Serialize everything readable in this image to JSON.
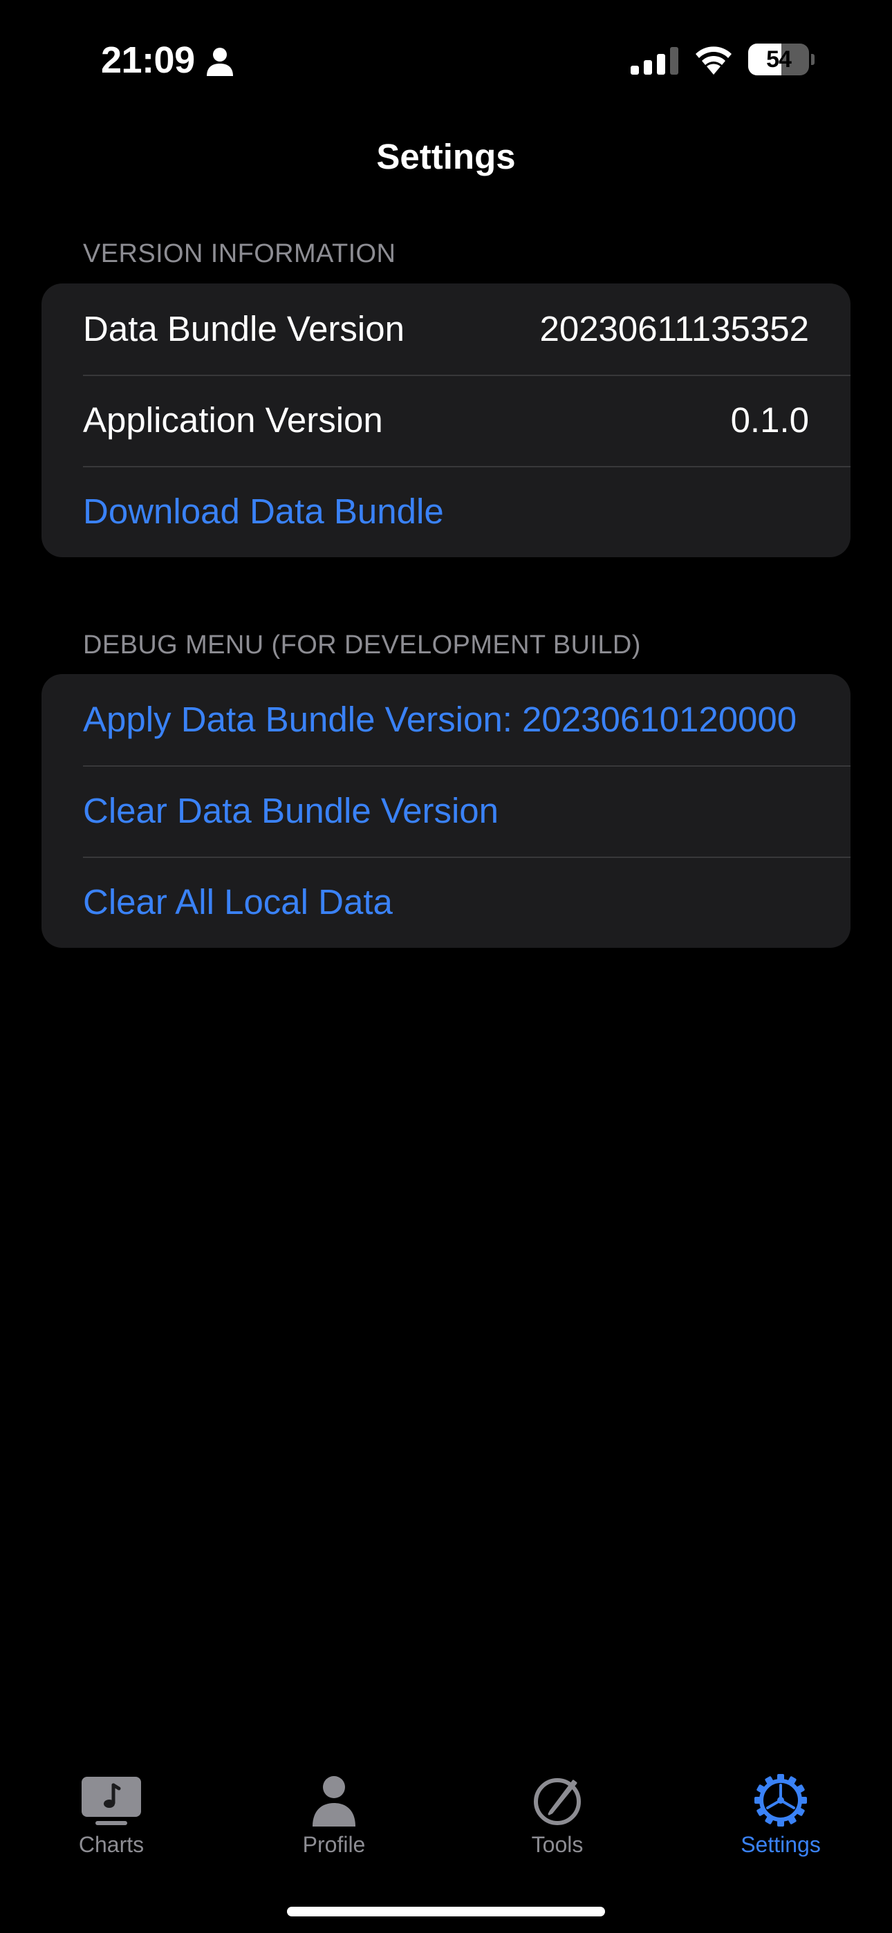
{
  "status_bar": {
    "time": "21:09",
    "battery_percent": 54,
    "battery_label": "54",
    "signal_bars": 3
  },
  "nav": {
    "title": "Settings"
  },
  "sections": {
    "version": {
      "header": "VERSION INFORMATION",
      "rows": [
        {
          "label": "Data Bundle Version",
          "value": "20230611135352"
        },
        {
          "label": "Application Version",
          "value": "0.1.0"
        }
      ],
      "download_link": "Download Data Bundle"
    },
    "debug": {
      "header": "DEBUG MENU (FOR DEVELOPMENT BUILD)",
      "actions": [
        "Apply Data Bundle Version: 20230610120000",
        "Clear Data Bundle Version",
        "Clear All Local Data"
      ]
    }
  },
  "tab_bar": {
    "tabs": [
      {
        "label": "Charts",
        "icon": "music-note-tv-icon"
      },
      {
        "label": "Profile",
        "icon": "person-icon"
      },
      {
        "label": "Tools",
        "icon": "pencil-circle-icon"
      },
      {
        "label": "Settings",
        "icon": "gear-icon",
        "active": true
      }
    ]
  },
  "colors": {
    "accent": "#3a82f7",
    "background": "#000000",
    "group_background": "#1c1c1e",
    "secondary_text": "#8d8d93"
  }
}
